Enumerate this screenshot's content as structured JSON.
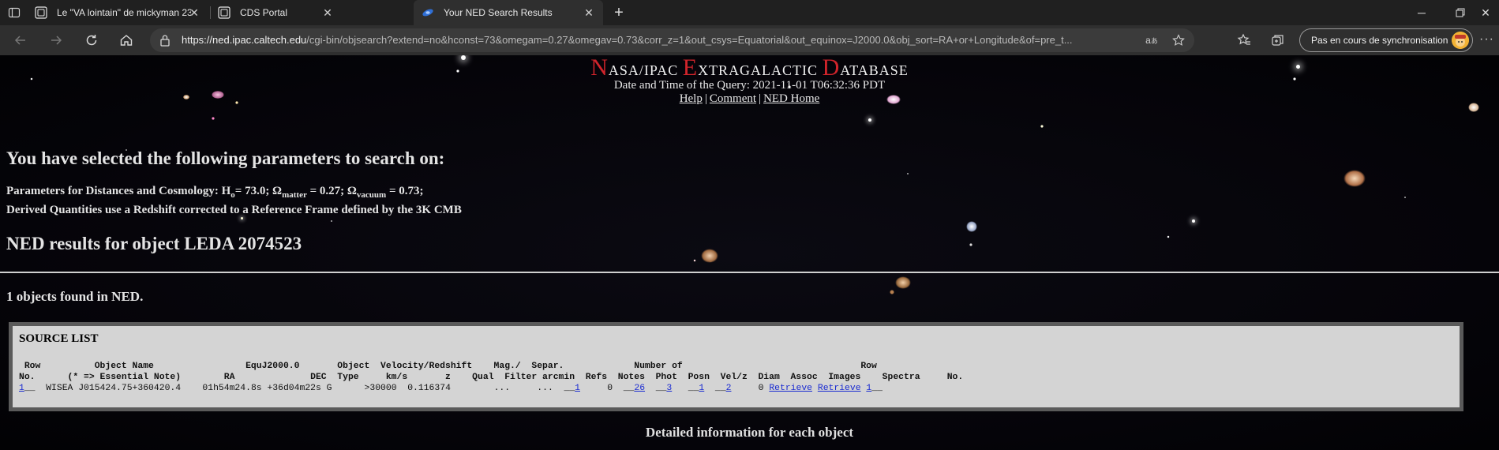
{
  "tabs": [
    {
      "title": "Le \"VA lointain\" de mickyman 23",
      "icon": "forum-favicon-icon"
    },
    {
      "title": "CDS Portal",
      "icon": "cds-favicon-icon"
    },
    {
      "title": "Your NED Search Results",
      "icon": "ned-favicon-icon",
      "active": true
    }
  ],
  "address": {
    "host": "https://ned.ipac.caltech.edu",
    "path": "/cgi-bin/objsearch?extend=no&hconst=73&omegam=0.27&omegav=0.73&corr_z=1&out_csys=Equatorial&out_equinox=J2000.0&obj_sort=RA+or+Longitude&of=pre_t..."
  },
  "sync_button": {
    "label": "Pas en cours de synchronisation"
  },
  "ned": {
    "title_parts": [
      {
        "big": "N",
        "small": "ASA/IPAC "
      },
      {
        "big": "E",
        "small": "XTRAGALACTIC "
      },
      {
        "big": "D",
        "small": "ATABASE"
      }
    ],
    "date_line": "Date and Time of the Query: 2021-11-01 T06:32:36 PDT",
    "links": {
      "help": "Help",
      "comment": "Comment",
      "home": "NED Home",
      "sep": "|"
    },
    "params_heading": "You have selected the following parameters to search on:",
    "params_line1": {
      "prefix": "Parameters for Distances and Cosmology: H",
      "h_sub": "o",
      "h_val": "= 73.0; Ω",
      "m_sub": "matter",
      "m_val": " = 0.27; Ω",
      "v_sub": "vacuum",
      "v_val": " = 0.73;"
    },
    "params_line2": "Derived Quantities use a Redshift corrected to a Reference Frame defined by the 3K CMB",
    "results_heading": "NED results for object LEDA 2074523",
    "found_text": "1 objects found in NED.",
    "source_list": {
      "title": "SOURCE LIST",
      "header_line1": " Row          Object Name                 EquJ2000.0       Object  Velocity/Redshift    Mag./  Separ.             Number of                                 Row",
      "header_line2": "No.      (* => Essential Note)        RA              DEC  Type     km/s       z    Qual  Filter arcmin  Refs  Notes  Phot  Posn  Vel/z  Diam  Assoc  Images    Spectra     No.",
      "row": {
        "no": "1",
        "name": "WISEA J015424.75+360420.4",
        "ra": "01h54m24.8s",
        "dec": "+36d04m22s",
        "type": "G",
        "vel": ">30000",
        "z": "0.116374",
        "qual": "",
        "mag": "...",
        "separ": "...",
        "refs": "1",
        "notes": "0",
        "phot": "26",
        "posn": "3",
        "velz": "1",
        "diam": "2",
        "assoc": "0",
        "images": "Retrieve",
        "spectra": "Retrieve",
        "rowno": "1"
      }
    },
    "detail_heading": "Detailed information for each object"
  }
}
